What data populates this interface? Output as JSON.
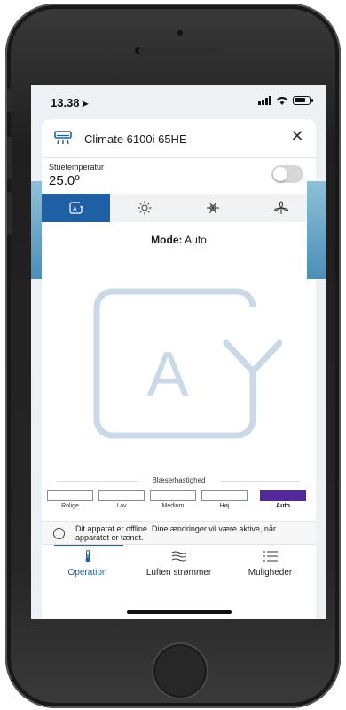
{
  "status_bar": {
    "time": "13.38",
    "location_glyph": "➤"
  },
  "header": {
    "device_name": "Climate 6100i 65HE",
    "close_glyph": "✕"
  },
  "temperature": {
    "label": "Stuetemperatur",
    "value": "25.0º",
    "power_on": false
  },
  "modes": {
    "selected": "auto",
    "tabs": [
      {
        "id": "auto",
        "icon": "auto-mode-icon"
      },
      {
        "id": "heat",
        "icon": "sun-icon"
      },
      {
        "id": "cool",
        "icon": "snowflake-icon"
      },
      {
        "id": "fan",
        "icon": "fan-icon"
      }
    ]
  },
  "mode_line": {
    "label": "Mode:",
    "value": "Auto",
    "big_letter": "A"
  },
  "fan_speed": {
    "title": "Blæserhastighed",
    "selected": "Auto",
    "options": [
      "Rolige",
      "Lav",
      "Medium",
      "Høj",
      "Auto"
    ]
  },
  "notice": {
    "icon_text": "!",
    "text": "Dit apparat er offline. Dine ændringer vil være aktive, når apparatet er tændt."
  },
  "bottom_nav": {
    "selected": "Operation",
    "items": [
      {
        "label": "Operation",
        "icon": "thermometer-icon"
      },
      {
        "label": "Luften strømmer",
        "icon": "airflow-icon"
      },
      {
        "label": "Muligheder",
        "icon": "list-icon"
      }
    ]
  },
  "colors": {
    "accent": "#1f5fa3",
    "fan_selected": "#54279d",
    "mode_graphic": "#c9d9e8"
  }
}
